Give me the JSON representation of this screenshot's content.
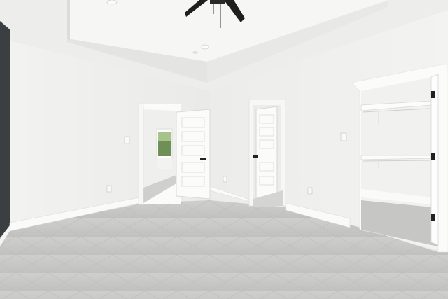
{
  "scene": {
    "type": "photo",
    "subject": "empty-bedroom-interior",
    "colors": {
      "wall": "#f1f1ef",
      "ceiling": "#f4f4f3",
      "carpet": "#c9c9c7",
      "accent_wall": "#3b3f42",
      "trim": "#fafaf9",
      "fan": "#1f1f1f"
    },
    "objects": [
      "ceiling-fan",
      "tray-ceiling",
      "recessed-lights",
      "accent-wall",
      "left-doorway",
      "bedroom-door",
      "window",
      "center-door",
      "walk-in-closet",
      "closet-shelf",
      "closet-rod",
      "light-switch",
      "electrical-outlet",
      "baseboard",
      "carpet-floor"
    ]
  }
}
